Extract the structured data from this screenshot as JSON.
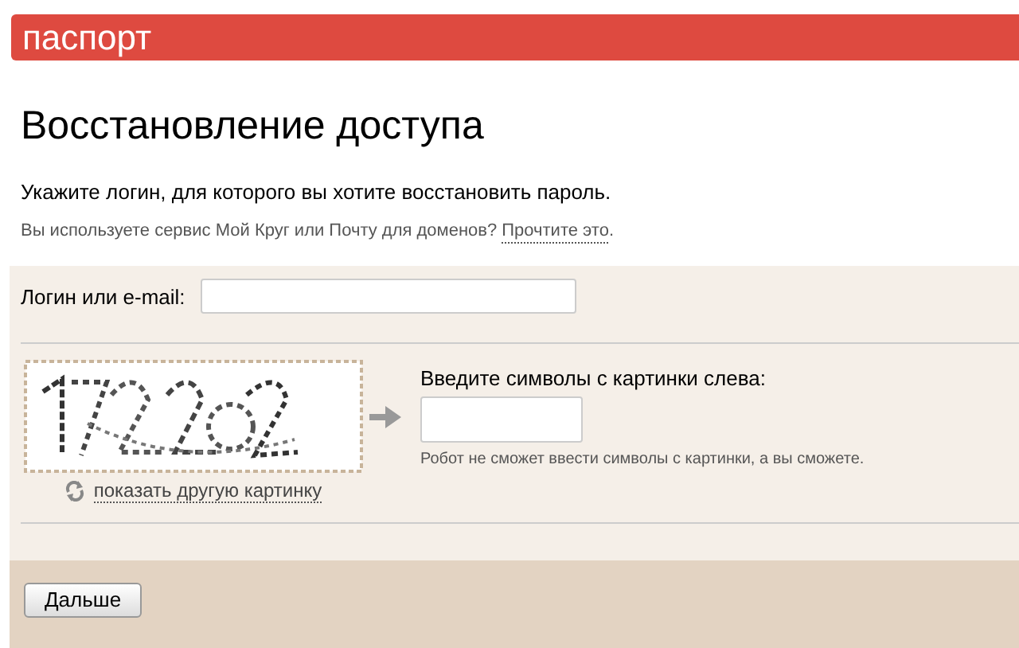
{
  "header": {
    "logo": "паспорт"
  },
  "title": "Восстановление доступа",
  "intro": "Укажите логин, для которого вы хотите восстановить пароль.",
  "note": {
    "text": "Вы используете сервис Мой Круг или Почту для доменов?",
    "link": "Прочтите это",
    "end": "."
  },
  "login": {
    "label": "Логин или e-mail:"
  },
  "captcha": {
    "label": "Введите символы с картинки слева:",
    "hint": "Робот не сможет ввести символы с картинки, а вы сможете.",
    "refresh_link": "показать другую картинку"
  },
  "buttons": [
    "Дальше"
  ]
}
